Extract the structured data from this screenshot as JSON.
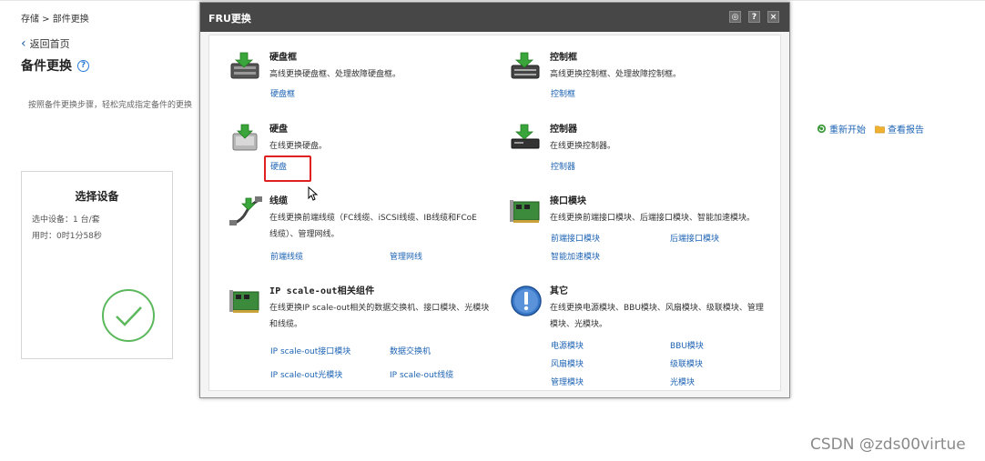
{
  "breadcrumb": "存储 > 部件更换",
  "back_label": "返回首页",
  "page_title": "备件更换",
  "page_desc": "按照备件更换步骤，轻松完成指定备件的更换",
  "actions": {
    "restart": "重新开始",
    "report": "查看报告"
  },
  "step_card": {
    "title": "选择设备",
    "selected": "选中设备：1 台/套",
    "elapsed": "用时：0时1分58秒"
  },
  "watermark": "CSDN @zds00virtue",
  "modal": {
    "title": "FRU更换",
    "buttons": {
      "settings": "◎",
      "help": "?",
      "close": "×"
    },
    "categories": {
      "enclosure": {
        "name": "硬盘框",
        "desc": [
          "高线更换硬盘框、处理故障硬盘框。"
        ],
        "links": [
          "硬盘框"
        ]
      },
      "controller_enclosure": {
        "name": "控制框",
        "desc": [
          "高线更换控制框、处理故障控制框。"
        ],
        "links": [
          "控制框"
        ]
      },
      "disk": {
        "name": "硬盘",
        "desc": [
          "在线更换硬盘。"
        ],
        "links": [
          "硬盘"
        ]
      },
      "controller": {
        "name": "控制器",
        "desc": [
          "在线更换控制器。"
        ],
        "links": [
          "控制器"
        ]
      },
      "cable": {
        "name": "线缆",
        "desc": [
          "在线更换前端线缆（FC线缆、iSCSI线缆、IB线缆和FCoE",
          "线缆）、管理网线。"
        ],
        "links": [
          "前端线缆",
          "管理网线"
        ]
      },
      "interface_module": {
        "name": "接口模块",
        "desc": [
          "在线更换前端接口模块、后端接口模块、智能加速模块。"
        ],
        "links": [
          "前端接口模块",
          "后端接口模块",
          "智能加速模块"
        ]
      },
      "scaleout": {
        "name": "IP scale-out相关组件",
        "desc": [
          "在线更换IP scale-out相关的数据交换机、接口模块、光模块",
          "和线缆。"
        ],
        "links": [
          "IP scale-out接口模块",
          "数据交换机",
          "IP scale-out光模块",
          "IP scale-out线缆"
        ]
      },
      "other": {
        "name": "其它",
        "desc": [
          "在线更换电源模块、BBU模块、风扇模块、级联模块、管理",
          "模块、光模块。"
        ],
        "links": [
          "电源模块",
          "BBU模块",
          "风扇模块",
          "级联模块",
          "管理模块",
          "光模块"
        ]
      }
    }
  },
  "colors": {
    "link": "#1e64b4",
    "header": "#474747",
    "highlight": "#e02020",
    "check": "#5cb85c"
  }
}
